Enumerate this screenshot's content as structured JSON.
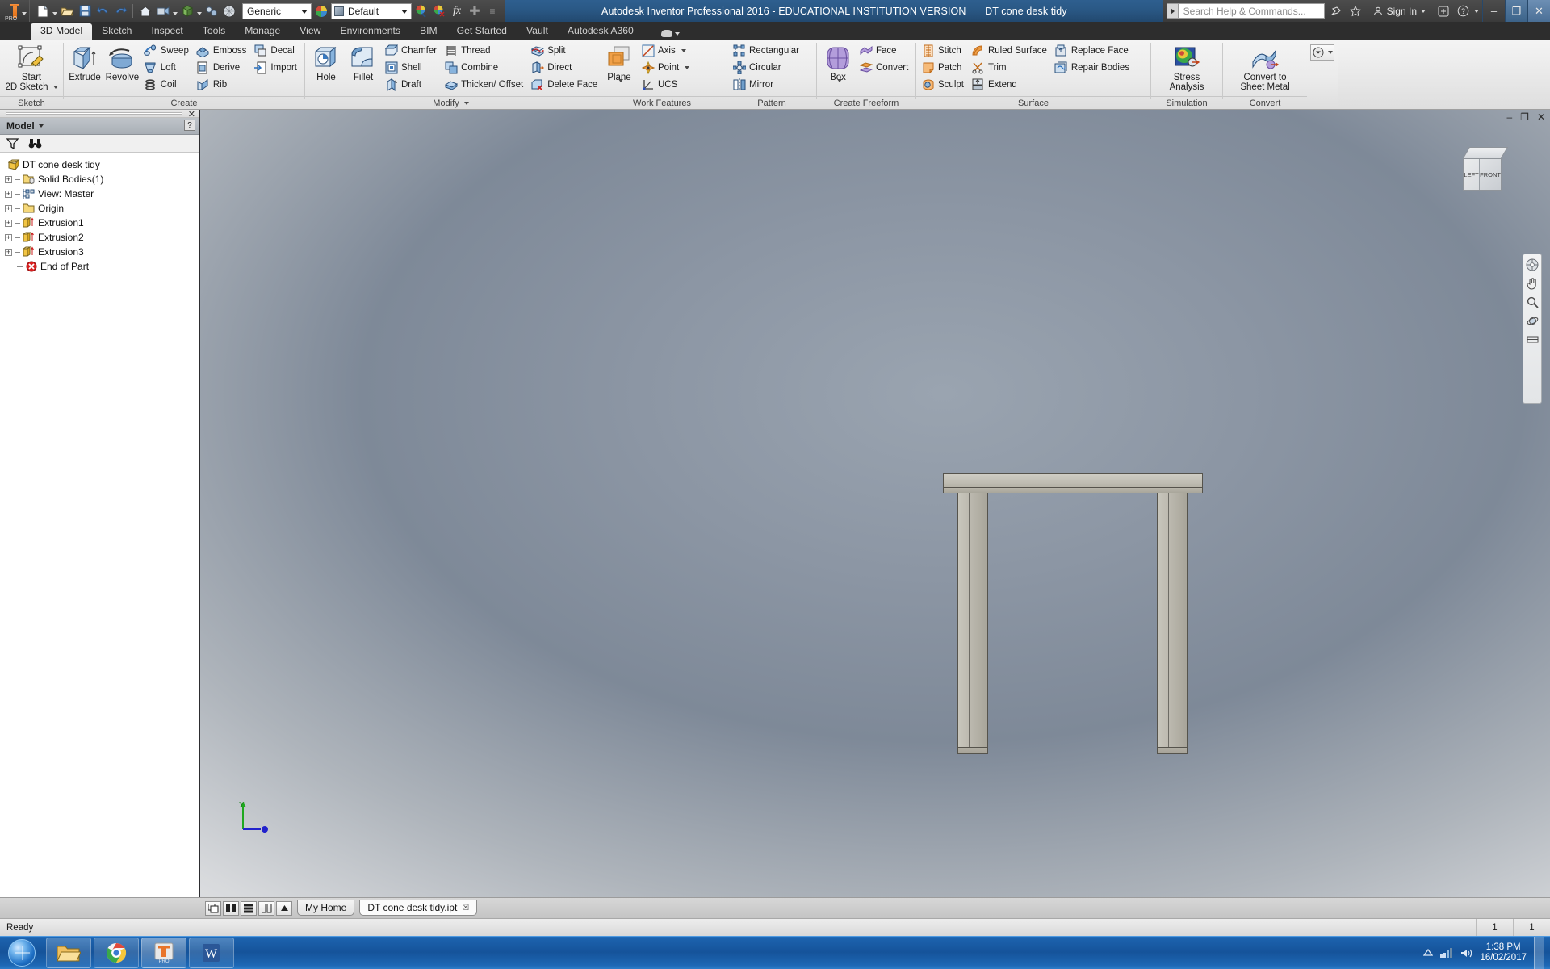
{
  "window": {
    "title": "Autodesk Inventor Professional 2016 - EDUCATIONAL INSTITUTION VERSION",
    "document_title": "DT cone desk tidy",
    "app_button": "inventor-pro-logo",
    "minimize": "–",
    "restore": "❐",
    "close": "✕"
  },
  "quick_access": {
    "items": [
      {
        "name": "new-button",
        "icon": "new-document-icon"
      },
      {
        "name": "open-button",
        "icon": "open-folder-icon"
      },
      {
        "name": "save-button",
        "icon": "save-disk-icon"
      },
      {
        "name": "undo-button",
        "icon": "undo-arrow-icon"
      },
      {
        "name": "redo-button",
        "icon": "redo-arrow-icon"
      },
      {
        "name": "home-button",
        "icon": "home-icon"
      },
      {
        "name": "appearance-button",
        "icon": "appearance-paint-icon"
      },
      {
        "name": "return-button",
        "icon": "return-block-icon"
      },
      {
        "name": "update-button",
        "icon": "update-icon"
      },
      {
        "name": "material-sphere-button",
        "icon": "material-sphere-icon"
      }
    ],
    "material_combo": "Generic",
    "appearance_combo": "Default",
    "adjust_icon": "adjust-color-icon",
    "clear_icon": "clear-appearance-icon",
    "fx_icon": "fx-parameters-icon",
    "plus_icon": "plus-icon",
    "more_icon": "more-options-icon"
  },
  "search": {
    "placeholder": "Search Help & Commands...",
    "expander_icon": "expand-arrow-icon",
    "help_icon": "help-satellite-icon",
    "star_icon": "favorites-star-icon",
    "sign_in_label": "Sign In",
    "sign_in_icon": "user-icon",
    "sign_in_caret": "chevron-down-icon",
    "exchange_icon": "app-exchange-icon",
    "question_icon": "question-help-icon"
  },
  "ribbon": {
    "tabs": [
      {
        "label": "3D Model",
        "active": true
      },
      {
        "label": "Sketch",
        "active": false
      },
      {
        "label": "Inspect",
        "active": false
      },
      {
        "label": "Tools",
        "active": false
      },
      {
        "label": "Manage",
        "active": false
      },
      {
        "label": "View",
        "active": false
      },
      {
        "label": "Environments",
        "active": false
      },
      {
        "label": "BIM",
        "active": false
      },
      {
        "label": "Get Started",
        "active": false
      },
      {
        "label": "Vault",
        "active": false
      },
      {
        "label": "Autodesk A360",
        "active": false
      }
    ],
    "panels": [
      {
        "name": "sketch",
        "label": "Sketch",
        "big": [
          {
            "label": "Start\n2D Sketch",
            "line1": "Start",
            "line2": "2D Sketch",
            "icon": "start-2d-sketch-icon",
            "dropdown": true
          }
        ],
        "small": []
      },
      {
        "name": "create",
        "label": "Create",
        "big": [
          {
            "line1": "Extrude",
            "line2": "",
            "icon": "extrude-icon"
          },
          {
            "line1": "Revolve",
            "line2": "",
            "icon": "revolve-icon"
          }
        ],
        "cols": [
          [
            {
              "label": "Sweep",
              "icon": "sweep-icon"
            },
            {
              "label": "Loft",
              "icon": "loft-icon"
            },
            {
              "label": "Coil",
              "icon": "coil-icon"
            }
          ],
          [
            {
              "label": "Emboss",
              "icon": "emboss-icon"
            },
            {
              "label": "Derive",
              "icon": "derive-icon"
            },
            {
              "label": "Rib",
              "icon": "rib-icon"
            }
          ],
          [
            {
              "label": "Decal",
              "icon": "decal-icon"
            },
            {
              "label": "Import",
              "icon": "import-icon"
            }
          ]
        ]
      },
      {
        "name": "modify",
        "label": "Modify",
        "label_dropdown": true,
        "big": [
          {
            "line1": "Hole",
            "line2": "",
            "icon": "hole-icon"
          },
          {
            "line1": "Fillet",
            "line2": "",
            "icon": "fillet-icon"
          }
        ],
        "cols": [
          [
            {
              "label": "Chamfer",
              "icon": "chamfer-icon"
            },
            {
              "label": "Shell",
              "icon": "shell-icon"
            },
            {
              "label": "Draft",
              "icon": "draft-icon"
            }
          ],
          [
            {
              "label": "Thread",
              "icon": "thread-icon"
            },
            {
              "label": "Combine",
              "icon": "combine-icon"
            },
            {
              "label": "Thicken/ Offset",
              "icon": "thicken-offset-icon"
            }
          ],
          [
            {
              "label": "Split",
              "icon": "split-icon"
            },
            {
              "label": "Direct",
              "icon": "direct-edit-icon"
            },
            {
              "label": "Delete Face",
              "icon": "delete-face-icon"
            }
          ]
        ]
      },
      {
        "name": "work-features",
        "label": "Work Features",
        "big": [
          {
            "line1": "Plane",
            "line2": "",
            "icon": "work-plane-icon",
            "dropdown": true
          }
        ],
        "cols": [
          [
            {
              "label": "Axis",
              "icon": "work-axis-icon",
              "dropdown": true
            },
            {
              "label": "Point",
              "icon": "work-point-icon",
              "dropdown": true
            },
            {
              "label": "UCS",
              "icon": "ucs-icon"
            }
          ]
        ]
      },
      {
        "name": "pattern",
        "label": "Pattern",
        "big": [],
        "cols": [
          [
            {
              "label": "Rectangular",
              "icon": "rectangular-pattern-icon"
            },
            {
              "label": "Circular",
              "icon": "circular-pattern-icon"
            },
            {
              "label": "Mirror",
              "icon": "mirror-icon"
            }
          ]
        ]
      },
      {
        "name": "create-freeform",
        "label": "Create Freeform",
        "big": [
          {
            "line1": "Box",
            "line2": "",
            "icon": "freeform-box-icon",
            "dropdown": true
          }
        ],
        "cols": [
          [
            {
              "label": "Face",
              "icon": "freeform-face-icon"
            },
            {
              "label": "Convert",
              "icon": "freeform-convert-icon"
            }
          ]
        ]
      },
      {
        "name": "surface",
        "label": "Surface",
        "big": [],
        "cols": [
          [
            {
              "label": "Stitch",
              "icon": "stitch-icon"
            },
            {
              "label": "Patch",
              "icon": "patch-icon"
            },
            {
              "label": "Sculpt",
              "icon": "sculpt-icon"
            }
          ],
          [
            {
              "label": "Ruled Surface",
              "icon": "ruled-surface-icon"
            },
            {
              "label": "Trim",
              "icon": "trim-icon"
            },
            {
              "label": "Extend",
              "icon": "extend-icon"
            }
          ],
          [
            {
              "label": "Replace Face",
              "icon": "replace-face-icon"
            },
            {
              "label": "Repair Bodies",
              "icon": "repair-bodies-icon"
            }
          ]
        ]
      },
      {
        "name": "simulation",
        "label": "Simulation",
        "big": [
          {
            "line1": "Stress",
            "line2": "Analysis",
            "icon": "stress-analysis-icon"
          }
        ],
        "cols": []
      },
      {
        "name": "convert",
        "label": "Convert",
        "big": [
          {
            "line1": "Convert to",
            "line2": "Sheet Metal",
            "icon": "convert-sheet-metal-icon"
          }
        ],
        "cols": []
      }
    ],
    "overflow_icon": "ribbon-overflow-icon"
  },
  "browser": {
    "title": "Model",
    "title_caret": "chevron-down-icon",
    "help_badge": "?",
    "close_icon": "✕",
    "tools": [
      {
        "name": "filter-button",
        "icon": "filter-funnel-icon"
      },
      {
        "name": "find-button",
        "icon": "binoculars-find-icon"
      }
    ],
    "tree": [
      {
        "label": "DT cone desk tidy",
        "indent": 0,
        "expander": null,
        "icon": "part-cube-icon"
      },
      {
        "label": "Solid Bodies(1)",
        "indent": 1,
        "expander": "+",
        "icon": "solid-bodies-folder-icon"
      },
      {
        "label": "View: Master",
        "indent": 1,
        "expander": "+",
        "icon": "view-master-icon"
      },
      {
        "label": "Origin",
        "indent": 1,
        "expander": "+",
        "icon": "origin-folder-icon"
      },
      {
        "label": "Extrusion1",
        "indent": 1,
        "expander": "+",
        "icon": "extrusion-icon"
      },
      {
        "label": "Extrusion2",
        "indent": 1,
        "expander": "+",
        "icon": "extrusion-icon"
      },
      {
        "label": "Extrusion3",
        "indent": 1,
        "expander": "+",
        "icon": "extrusion-icon"
      },
      {
        "label": "End of Part",
        "indent": 1,
        "expander": null,
        "icon": "end-of-part-icon"
      }
    ]
  },
  "viewport": {
    "minimize": "–",
    "restore": "❐",
    "close": "✕",
    "viewcube": {
      "left_label": "LEFT",
      "front_label": "FRONT"
    },
    "navbar": [
      {
        "name": "full-navigation-wheel-button",
        "icon": "steering-wheel-icon"
      },
      {
        "name": "pan-button",
        "icon": "pan-hand-icon"
      },
      {
        "name": "zoom-button",
        "icon": "zoom-magnifier-icon"
      },
      {
        "name": "orbit-button",
        "icon": "orbit-icon"
      },
      {
        "name": "look-at-button",
        "icon": "look-at-icon"
      }
    ],
    "triad": {
      "y_label": "Y",
      "z_label": "Z"
    },
    "model_name": "desk-model-3d"
  },
  "doc_tabs": {
    "view_buttons": [
      {
        "name": "cascade-windows-button",
        "icon": "cascade-icon"
      },
      {
        "name": "tile-windows-button",
        "icon": "tile-grid-icon"
      },
      {
        "name": "tile-horizontal-button",
        "icon": "tile-horizontal-icon"
      },
      {
        "name": "tile-vertical-button",
        "icon": "tile-vertical-icon"
      },
      {
        "name": "scroll-up-button",
        "icon": "chevron-up-icon"
      }
    ],
    "tabs": [
      {
        "label": "My Home",
        "active": false,
        "closable": false
      },
      {
        "label": "DT cone desk tidy.ipt",
        "active": true,
        "closable": true,
        "close_icon": "☒"
      }
    ]
  },
  "status_bar": {
    "message": "Ready",
    "cell1": "1",
    "cell2": "1"
  },
  "taskbar": {
    "start_button": "windows-start-orb",
    "items": [
      {
        "name": "taskbar-file-explorer",
        "icon": "folder-icon",
        "active": false
      },
      {
        "name": "taskbar-chrome",
        "icon": "chrome-icon",
        "active": false
      },
      {
        "name": "taskbar-inventor",
        "icon": "inventor-icon",
        "active": true
      },
      {
        "name": "taskbar-word",
        "icon": "word-icon",
        "active": false
      }
    ],
    "tray": {
      "show_hidden_icon": "chevron-up-icon",
      "network_icon": "network-icon",
      "volume_icon": "volume-icon",
      "time": "1:38 PM",
      "date": "16/02/2017"
    }
  },
  "colors": {
    "title_blue": "#2a5885",
    "ribbon_bg": "#eaeaea",
    "accent_orange": "#e06c10",
    "taskbar_blue": "#15539a",
    "model_gray": "#bcb9af"
  }
}
